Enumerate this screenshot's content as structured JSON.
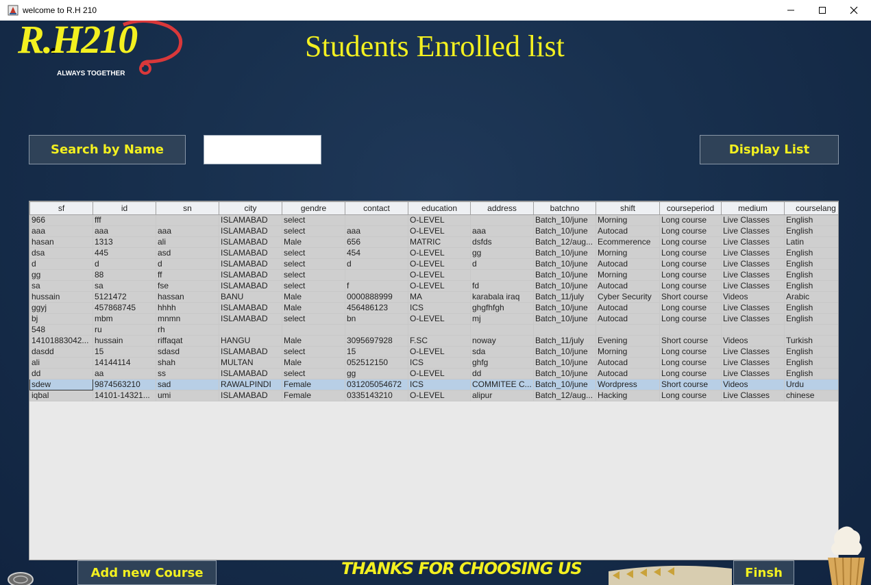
{
  "window": {
    "title": "welcome to R.H 210"
  },
  "logo": {
    "text": "R.H210",
    "tagline": "ALWAYS TOGETHER"
  },
  "page_title": "Students Enrolled list",
  "search": {
    "button_label": "Search by Name",
    "value": ""
  },
  "display_button_label": "Display List",
  "table": {
    "columns": [
      "sf",
      "id",
      "sn",
      "city",
      "gendre",
      "contact",
      "education",
      "address",
      "batchno",
      "shift",
      "courseperiod",
      "medium",
      "courselang"
    ],
    "rows": [
      [
        "966",
        "fff",
        "",
        "ISLAMABAD",
        "select",
        "",
        "O-LEVEL",
        "",
        "Batch_10/june",
        "Morning",
        "Long course",
        "Live Classes",
        "English"
      ],
      [
        "aaa",
        "aaa",
        "aaa",
        "ISLAMABAD",
        "select",
        "aaa",
        "O-LEVEL",
        "aaa",
        "Batch_10/june",
        "Autocad",
        "Long course",
        "Live Classes",
        "English"
      ],
      [
        "hasan",
        "1313",
        "ali",
        "ISLAMABAD",
        "Male",
        "656",
        "MATRIC",
        "dsfds",
        "Batch_12/aug...",
        "Ecommerence",
        "Long course",
        "Live Classes",
        "Latin"
      ],
      [
        "dsa",
        "445",
        "asd",
        "ISLAMABAD",
        "select",
        "454",
        "O-LEVEL",
        "gg",
        "Batch_10/june",
        "Morning",
        "Long course",
        "Live Classes",
        "English"
      ],
      [
        "d",
        "d",
        "d",
        "ISLAMABAD",
        "select",
        "d",
        "O-LEVEL",
        "d",
        "Batch_10/june",
        "Autocad",
        "Long course",
        "Live Classes",
        "English"
      ],
      [
        "gg",
        "88",
        "ff",
        "ISLAMABAD",
        "select",
        "",
        "O-LEVEL",
        "",
        "Batch_10/june",
        "Morning",
        "Long course",
        "Live Classes",
        "English"
      ],
      [
        "sa",
        "sa",
        "fse",
        "ISLAMABAD",
        "select",
        "f",
        "O-LEVEL",
        "fd",
        "Batch_10/june",
        "Autocad",
        "Long course",
        "Live Classes",
        "English"
      ],
      [
        "hussain",
        "5121472",
        "hassan",
        "BANU",
        "Male",
        "0000888999",
        "MA",
        "karabala iraq",
        "Batch_11/july",
        "Cyber Security",
        "Short course",
        "Videos",
        "Arabic"
      ],
      [
        "ggyj",
        "457868745",
        "hhhh",
        "ISLAMABAD",
        "Male",
        "456486123",
        "ICS",
        "ghgfhfgh",
        "Batch_10/june",
        "Autocad",
        "Long course",
        "Live Classes",
        "English"
      ],
      [
        "bj",
        "mbm",
        "mnmn",
        "ISLAMABAD",
        "select",
        "bn",
        "O-LEVEL",
        "mj",
        "Batch_10/june",
        "Autocad",
        "Long course",
        "Live Classes",
        "English"
      ],
      [
        "548",
        "ru",
        "rh",
        "",
        "",
        "",
        "",
        "",
        "",
        "",
        "",
        "",
        ""
      ],
      [
        "14101883042...",
        "hussain",
        "riffaqat",
        "HANGU",
        "Male",
        "3095697928",
        "F.SC",
        "noway",
        "Batch_11/july",
        "Evening",
        "Short course",
        "Videos",
        "Turkish"
      ],
      [
        "dasdd",
        "15",
        "sdasd",
        "ISLAMABAD",
        "select",
        "15",
        "O-LEVEL",
        "sda",
        "Batch_10/june",
        "Morning",
        "Long course",
        "Live Classes",
        "English"
      ],
      [
        "ali",
        "14144114",
        "shah",
        "MULTAN",
        "Male",
        "052512150",
        "ICS",
        "ghfg",
        "Batch_10/june",
        "Autocad",
        "Long course",
        "Live Classes",
        "English"
      ],
      [
        "dd",
        "aa",
        "ss",
        "ISLAMABAD",
        "select",
        "gg",
        "O-LEVEL",
        "dd",
        "Batch_10/june",
        "Autocad",
        "Long course",
        "Live Classes",
        "English"
      ],
      [
        "sdew",
        "9874563210",
        "sad",
        "RAWALPINDI",
        "Female",
        "031205054672",
        "ICS",
        "COMMITEE C...",
        "Batch_10/june",
        "Wordpress",
        "Short course",
        "Videos",
        "Urdu"
      ],
      [
        "iqbal",
        "14101-14321...",
        "umi",
        "ISLAMABAD",
        "Female",
        "0335143210",
        "O-LEVEL",
        "alipur",
        "Batch_12/aug...",
        "Hacking",
        "Long course",
        "Live Classes",
        "chinese"
      ]
    ],
    "selected_row": 15
  },
  "add_course_label": "Add new Course",
  "thanks_text": "THANKS FOR CHOOSING US",
  "finish_label": "Finsh",
  "colors": {
    "accent": "#f3f020",
    "background": "#18304e",
    "button": "#2f4258"
  }
}
